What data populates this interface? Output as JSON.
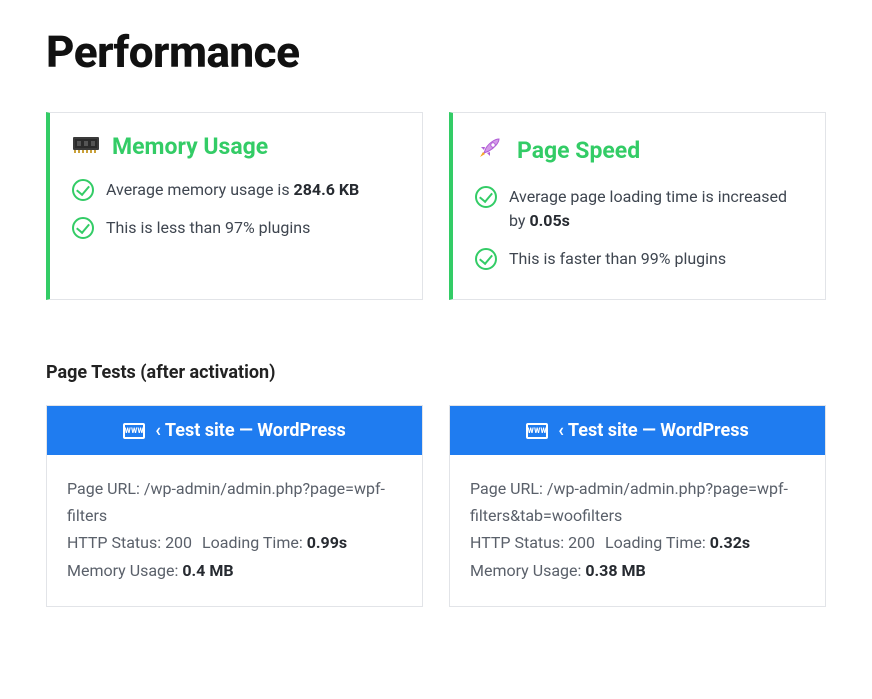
{
  "page_title": "Performance",
  "cards": {
    "memory": {
      "title": "Memory Usage",
      "bullets": [
        {
          "prefix": "Average memory usage is ",
          "strong": "284.6 KB",
          "suffix": ""
        },
        {
          "prefix": "This is less than 97% plugins",
          "strong": "",
          "suffix": ""
        }
      ]
    },
    "speed": {
      "title": "Page Speed",
      "bullets": [
        {
          "prefix": "Average page loading time is increased by ",
          "strong": "0.05s",
          "suffix": ""
        },
        {
          "prefix": "This is faster than 99% plugins",
          "strong": "",
          "suffix": ""
        }
      ]
    }
  },
  "tests_section_title": "Page Tests (after activation)",
  "tests": [
    {
      "header_label": "‹ Test site — WordPress",
      "page_url_label": "Page URL: ",
      "page_url": "/wp-admin/admin.php?page=wpf-filters",
      "http_status_label": "HTTP Status: ",
      "http_status": "200",
      "loading_time_label": "Loading Time: ",
      "loading_time": "0.99s",
      "memory_usage_label": "Memory Usage: ",
      "memory_usage": "0.4 MB"
    },
    {
      "header_label": "‹ Test site — WordPress",
      "page_url_label": "Page URL: ",
      "page_url": "/wp-admin/admin.php?page=wpf-filters&tab=woofilters",
      "http_status_label": "HTTP Status: ",
      "http_status": "200",
      "loading_time_label": "Loading Time: ",
      "loading_time": "0.32s",
      "memory_usage_label": "Memory Usage: ",
      "memory_usage": "0.38 MB"
    }
  ]
}
